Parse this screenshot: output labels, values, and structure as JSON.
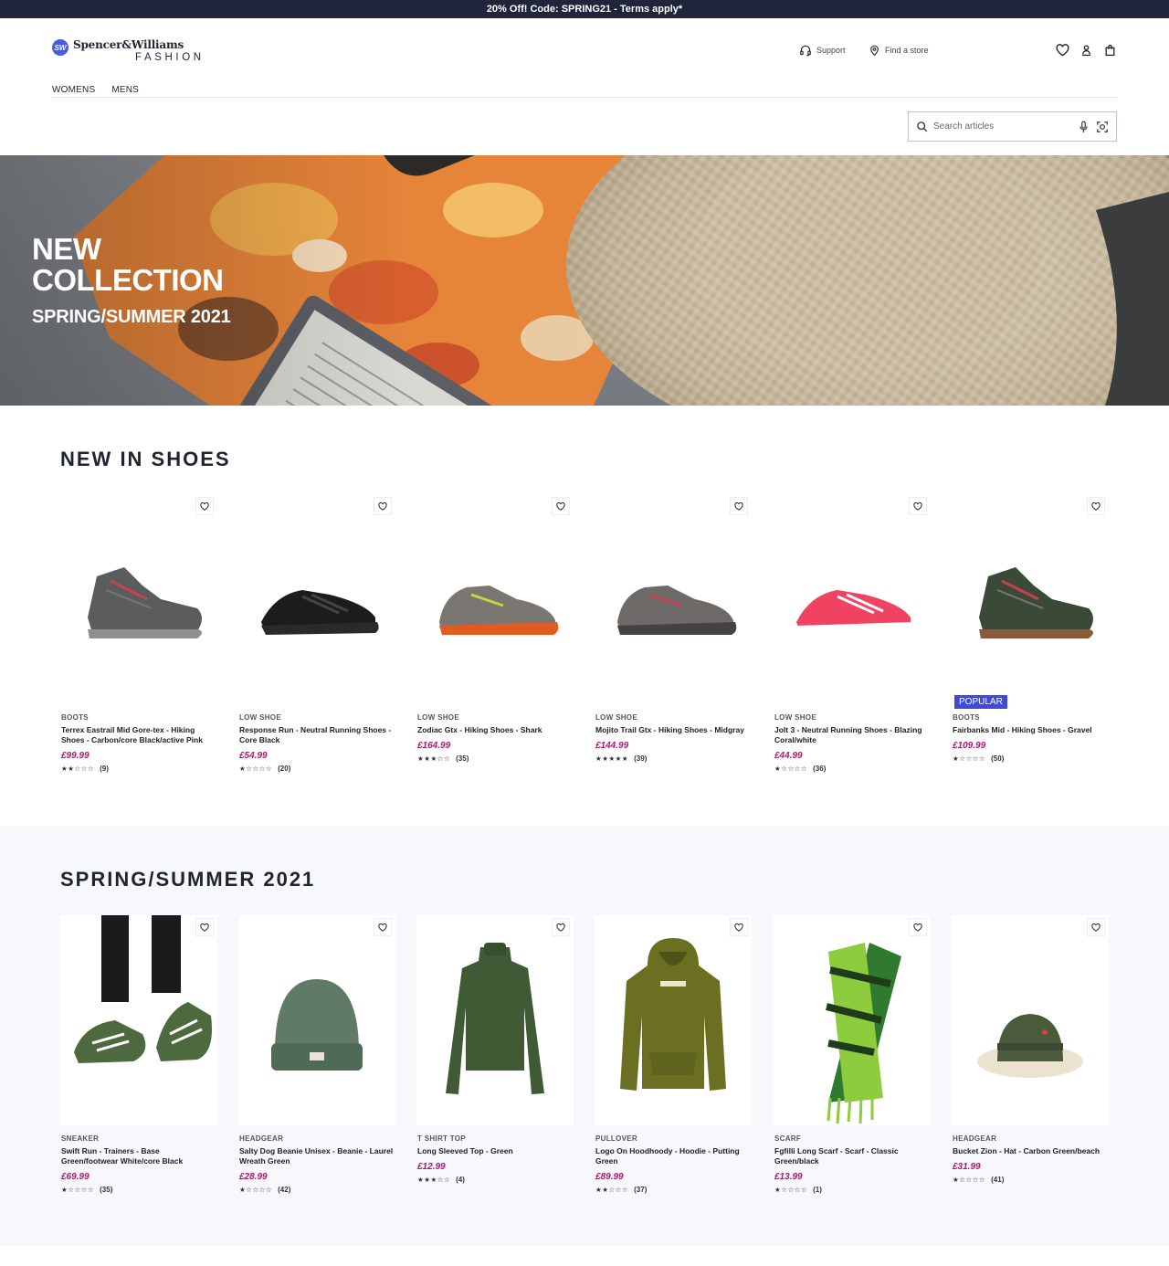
{
  "promo": {
    "text": "20% Off! Code: SPRING21 - Terms apply*"
  },
  "brand": {
    "mark": "SW",
    "name": "Spencer&Williams",
    "sub": "FASHION"
  },
  "utility": {
    "support": "Support",
    "store": "Find a store"
  },
  "nav": {
    "items": [
      "WOMENS",
      "MENS"
    ]
  },
  "search": {
    "placeholder": "Search articles"
  },
  "hero": {
    "line1": "NEW",
    "line2": "COLLECTION",
    "sub": "SPRING/SUMMER 2021"
  },
  "colors": {
    "promo_bg": "#21253b",
    "price": "#b1156f",
    "badge": "#3f4ad9",
    "brand": "#4a5be8"
  },
  "shoes": {
    "title": "NEW IN SHOES",
    "products": [
      {
        "category": "BOOTS",
        "name": "Terrex Eastrail Mid Gore-tex - Hiking Shoes - Carbon/core Black/active Pink",
        "price": "£99.99",
        "rating": 2,
        "reviews": "(9)",
        "icon": "boot-shoe"
      },
      {
        "category": "LOW SHOE",
        "name": "Response Run - Neutral Running Shoes - Core Black",
        "price": "£54.99",
        "rating": 1,
        "reviews": "(20)",
        "icon": "running-shoe"
      },
      {
        "category": "LOW SHOE",
        "name": "Zodiac Gtx - Hiking Shoes - Shark",
        "price": "£164.99",
        "rating": 3,
        "reviews": "(35)",
        "icon": "hiking-shoe"
      },
      {
        "category": "LOW SHOE",
        "name": "Mojito Trail Gtx - Hiking Shoes - Midgray",
        "price": "£144.99",
        "rating": 5,
        "reviews": "(39)",
        "icon": "hiking-shoe"
      },
      {
        "category": "LOW SHOE",
        "name": "Jolt 3 - Neutral Running Shoes - Blazing Coral/white",
        "price": "£44.99",
        "rating": 1,
        "reviews": "(36)",
        "icon": "running-shoe"
      },
      {
        "category": "BOOTS",
        "name": "Fairbanks Mid - Hiking Shoes - Gravel",
        "price": "£109.99",
        "rating": 1,
        "reviews": "(50)",
        "badge": "POPULAR",
        "icon": "boot-shoe"
      }
    ]
  },
  "spring": {
    "title": "SPRING/SUMMER 2021",
    "products": [
      {
        "category": "SNEAKER",
        "name": "Swift Run - Trainers - Base Green/footwear White/core Black",
        "price": "£69.99",
        "rating": 1,
        "reviews": "(35)",
        "icon": "sneaker"
      },
      {
        "category": "HEADGEAR",
        "name": "Salty Dog Beanie Unisex - Beanie - Laurel Wreath Green",
        "price": "£28.99",
        "rating": 1,
        "reviews": "(42)",
        "icon": "beanie"
      },
      {
        "category": "T SHIRT TOP",
        "name": "Long Sleeved Top - Green",
        "price": "£12.99",
        "rating": 3,
        "reviews": "(4)",
        "icon": "long-sleeve-top"
      },
      {
        "category": "PULLOVER",
        "name": "Logo On Hoodhoody - Hoodie - Putting Green",
        "price": "£89.99",
        "rating": 2,
        "reviews": "(37)",
        "icon": "hoodie"
      },
      {
        "category": "SCARF",
        "name": "Fgfilli Long Scarf - Scarf - Classic Green/black",
        "price": "£13.99",
        "rating": 1,
        "reviews": "(1)",
        "icon": "scarf"
      },
      {
        "category": "HEADGEAR",
        "name": "Bucket Zion - Hat - Carbon Green/beach",
        "price": "£31.99",
        "rating": 1,
        "reviews": "(41)",
        "icon": "bucket-hat"
      }
    ]
  }
}
